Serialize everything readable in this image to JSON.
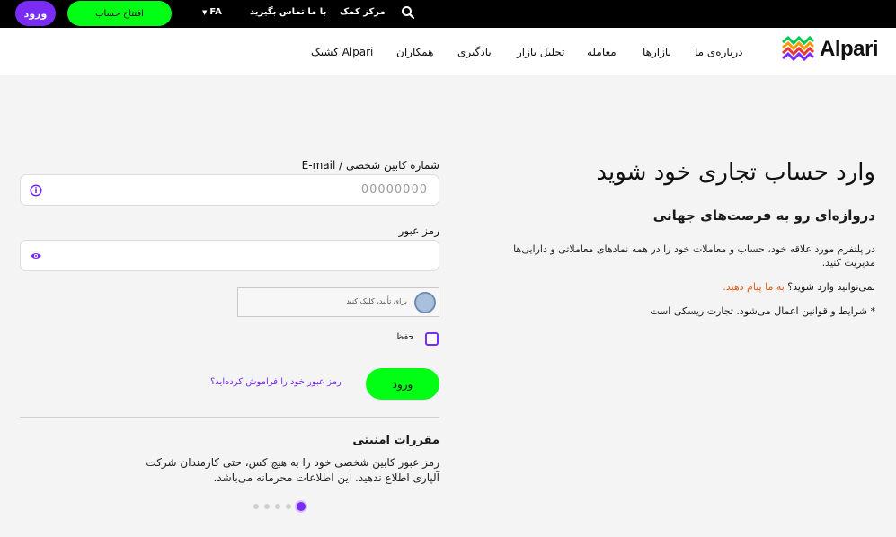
{
  "topbar": {
    "login_label": "ورود",
    "open_account_label": "افتتاح حساب",
    "language": "FA",
    "contact_label": "با ما تماس بگیرید",
    "help_center_label": "مرکز کمک"
  },
  "nav": {
    "brand": "Alpari",
    "items": [
      "درباره‌ی ما",
      "بازارها",
      "معامله",
      "تحلیل بازار",
      "یادگیری",
      "همکاران",
      "کشبک Alpari"
    ]
  },
  "form": {
    "account_label": "شماره کابین شخصی / E-mail",
    "account_placeholder": "00000000",
    "password_label": "رمز عبور",
    "captcha_text": "برای تأیید، کلیک کنید",
    "remember_label": "حفظ",
    "submit_label": "ورود",
    "forgot_label": "رمز عبور خود را فراموش کرده‌اید؟"
  },
  "security": {
    "title": "مقررات امنیتی",
    "text": "رمز عبور کابین شخصی خود را به هیچ کس، حتی کارمندان شرکت آلپاری اطلاع ندهید. این اطلاعات محرمانه می‌باشد.",
    "slides_total": 5,
    "active_slide": 1
  },
  "intro": {
    "title": "وارد حساب تجاری خود شوید",
    "subtitle": "دروازه‌ای رو به فرصت‌های جهانی",
    "description": "در پلتفرم مورد علاقه خود، حساب و معاملات خود را در همه نمادهای معاملاتی و دارایی‌ها مدیریت کنید.",
    "cant_login_prefix": "نمی‌توانید وارد شوید؟",
    "cant_login_link": "به ما پیام دهید.",
    "terms": "* شرایط و قوانین اعمال می‌شود. تجارت ریسکی است"
  },
  "colors": {
    "accent": "#7a2cf5",
    "primary_button": "#00ff15",
    "link_orange": "#e05a14"
  }
}
